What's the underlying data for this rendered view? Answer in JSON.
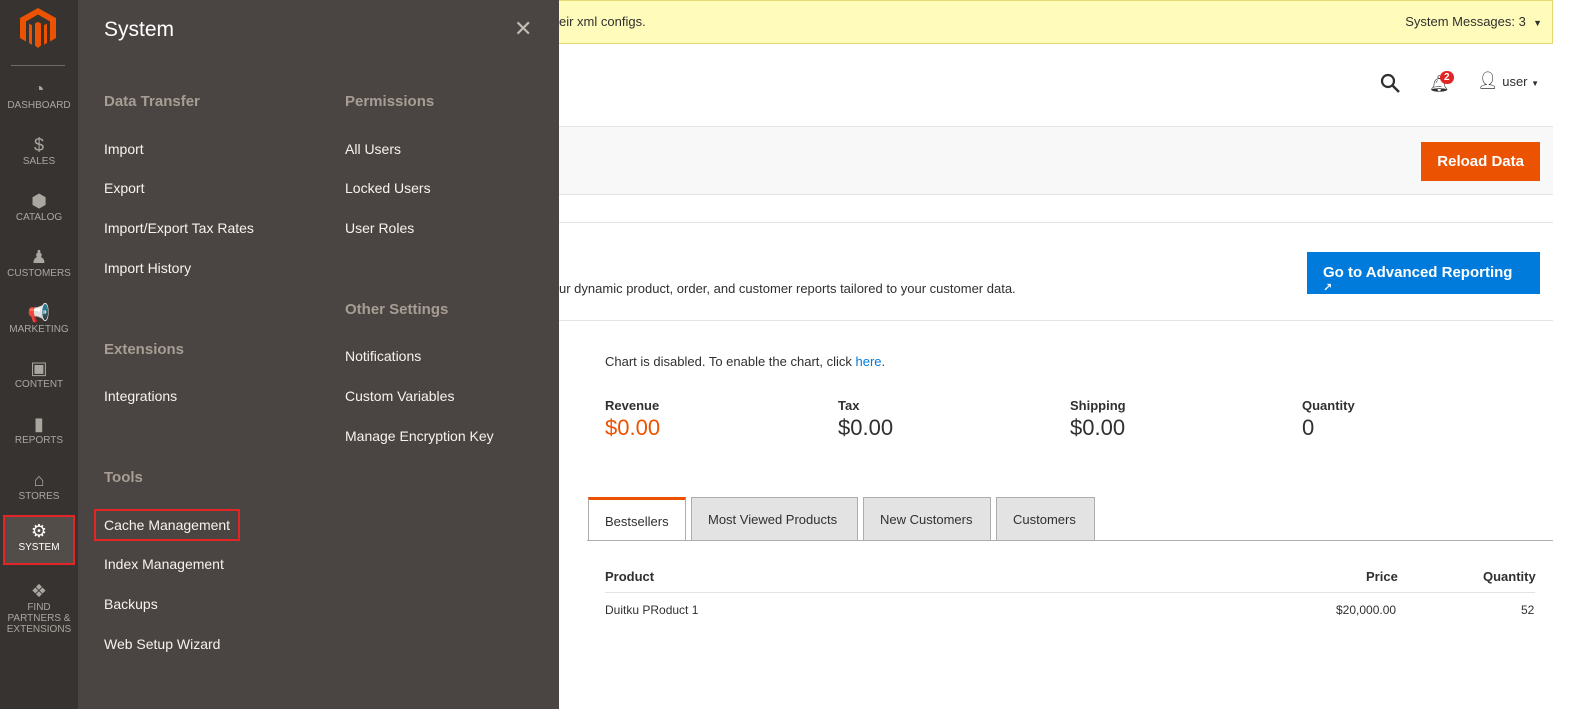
{
  "nav": {
    "items": [
      {
        "label": "DASHBOARD",
        "icon": "dashboard-icon",
        "glyph": "◔"
      },
      {
        "label": "SALES",
        "icon": "dollar-icon",
        "glyph": "$"
      },
      {
        "label": "CATALOG",
        "icon": "box-icon",
        "glyph": "⬢"
      },
      {
        "label": "CUSTOMERS",
        "icon": "person-icon",
        "glyph": "♟"
      },
      {
        "label": "MARKETING",
        "icon": "megaphone-icon",
        "glyph": "📢"
      },
      {
        "label": "CONTENT",
        "icon": "layout-icon",
        "glyph": "▣"
      },
      {
        "label": "REPORTS",
        "icon": "bar-chart-icon",
        "glyph": "▮"
      },
      {
        "label": "STORES",
        "icon": "store-icon",
        "glyph": "⌂"
      },
      {
        "label": "SYSTEM",
        "icon": "gear-icon",
        "glyph": "⚙"
      },
      {
        "label": "FIND PARTNERS & EXTENSIONS",
        "icon": "blocks-icon",
        "glyph": "❖"
      }
    ],
    "active": "SYSTEM"
  },
  "flyout": {
    "title": "System",
    "sections": {
      "data_transfer": "Data Transfer",
      "permissions": "Permissions",
      "other": "Other Settings",
      "extensions": "Extensions",
      "tools": "Tools"
    },
    "data_transfer": [
      "Import",
      "Export",
      "Import/Export Tax Rates",
      "Import History"
    ],
    "permissions": [
      "All Users",
      "Locked Users",
      "User Roles"
    ],
    "other": [
      "Notifications",
      "Custom Variables",
      "Manage Encryption Key"
    ],
    "extensions": [
      "Integrations"
    ],
    "tools": [
      "Cache Management",
      "Index Management",
      "Backups",
      "Web Setup Wizard"
    ]
  },
  "banner": {
    "text": "eir xml configs.",
    "system_messages": "System Messages: 3"
  },
  "header": {
    "notifications": "2",
    "user": "user"
  },
  "actions": {
    "reload": "Reload Data"
  },
  "reporting": {
    "text": "ur dynamic product, order, and customer reports tailored to your customer data.",
    "button": "Go to Advanced Reporting"
  },
  "chart": {
    "disabled": "Chart is disabled. To enable the chart, click ",
    "link": "here",
    "period": "."
  },
  "totals": [
    {
      "label": "Revenue",
      "value": "$0.00"
    },
    {
      "label": "Tax",
      "value": "$0.00"
    },
    {
      "label": "Shipping",
      "value": "$0.00"
    },
    {
      "label": "Quantity",
      "value": "0"
    }
  ],
  "tabs": [
    "Bestsellers",
    "Most Viewed Products",
    "New Customers",
    "Customers"
  ],
  "table": {
    "headers": [
      "Product",
      "Price",
      "Quantity"
    ],
    "rows": [
      [
        "Duitku PRoduct 1",
        "$20,000.00",
        "52"
      ]
    ]
  },
  "colors": {
    "accent": "#eb5202",
    "link": "#007bdb",
    "highlight": "#e22626"
  }
}
